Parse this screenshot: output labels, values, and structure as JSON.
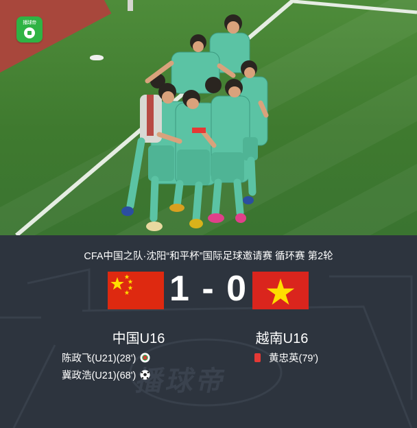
{
  "app": {
    "logo_text": "播球帝",
    "watermark_text": "播球帝"
  },
  "match": {
    "competition": "CFA中国之队·沈阳“和平杯”国际足球邀请赛  循环赛  第2轮",
    "score": "1 - 0",
    "home": {
      "name": "中国U16",
      "flag": "china-flag",
      "events": [
        {
          "text": "陈政飞(U21)(28')",
          "icon": "own-goal-icon"
        },
        {
          "text": "冀政浩(U21)(68')",
          "icon": "goal-ball-icon"
        }
      ]
    },
    "away": {
      "name": "越南U16",
      "flag": "vietnam-flag",
      "events": [
        {
          "text": "黄忠英(79')",
          "icon": "red-card-icon"
        }
      ]
    }
  },
  "colors": {
    "panel_bg": "#2d343e",
    "china_red": "#de2910",
    "vietnam_red": "#da251d",
    "star_yellow": "#ffde00",
    "kit_teal": "#5bc3a4"
  }
}
